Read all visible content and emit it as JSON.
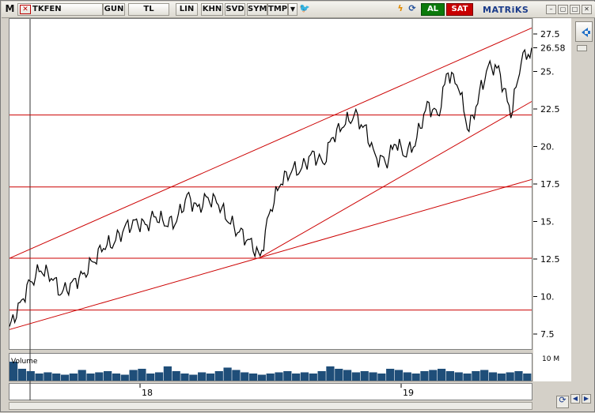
{
  "toolbar": {
    "menu_label": "M",
    "symbol": "TKFEN",
    "buttons": [
      "GUN",
      "TL",
      "LIN",
      "KHN",
      "SVD",
      "SYM",
      "TMP"
    ],
    "al_label": "AL",
    "sat_label": "SAT",
    "logo": "MATRiKS"
  },
  "colors": {
    "price_line": "#000000",
    "level_line": "#cc0000",
    "volume_bar": "#1f4e79",
    "current_price_tag": "#000000"
  },
  "chart_data": {
    "type": "line",
    "title": "",
    "xlabel": "",
    "ylabel": "",
    "ylim": [
      6.5,
      28.5
    ],
    "y_ticks": [
      "27.5",
      "25.",
      "22.5",
      "20.",
      "17.5",
      "15.",
      "12.5",
      "10.",
      "7.5"
    ],
    "y_tick_values": [
      27.5,
      25,
      22.5,
      20,
      17.5,
      15,
      12.5,
      10,
      7.5
    ],
    "current_price": "26.58",
    "x_tick_labels": [
      "18",
      "19"
    ],
    "x_tick_positions": [
      0.25,
      0.75
    ],
    "grid": false,
    "horizontal_levels": [
      22.1,
      17.3,
      12.55,
      9.1
    ],
    "trend_lines": [
      {
        "from": [
          0.0,
          12.55
        ],
        "to": [
          1.0,
          27.9
        ]
      },
      {
        "from": [
          0.0,
          7.8
        ],
        "to": [
          0.48,
          12.6
        ]
      },
      {
        "from": [
          0.48,
          12.6
        ],
        "to": [
          1.0,
          23.0
        ]
      },
      {
        "from": [
          0.48,
          12.6
        ],
        "to": [
          1.0,
          17.8
        ]
      }
    ],
    "series": [
      {
        "values": [
          [
            0.0,
            8.0
          ],
          [
            0.02,
            9.6
          ],
          [
            0.04,
            11.0
          ],
          [
            0.06,
            11.7
          ],
          [
            0.08,
            11.2
          ],
          [
            0.1,
            10.2
          ],
          [
            0.12,
            11.0
          ],
          [
            0.14,
            11.5
          ],
          [
            0.16,
            12.3
          ],
          [
            0.18,
            13.2
          ],
          [
            0.2,
            13.5
          ],
          [
            0.22,
            14.6
          ],
          [
            0.24,
            15.1
          ],
          [
            0.26,
            14.8
          ],
          [
            0.28,
            15.3
          ],
          [
            0.3,
            14.7
          ],
          [
            0.32,
            15.0
          ],
          [
            0.34,
            16.8
          ],
          [
            0.36,
            16.0
          ],
          [
            0.38,
            16.6
          ],
          [
            0.4,
            16.1
          ],
          [
            0.42,
            14.9
          ],
          [
            0.44,
            14.3
          ],
          [
            0.46,
            13.8
          ],
          [
            0.48,
            12.7
          ],
          [
            0.5,
            15.8
          ],
          [
            0.52,
            17.5
          ],
          [
            0.54,
            18.3
          ],
          [
            0.56,
            18.6
          ],
          [
            0.58,
            19.7
          ],
          [
            0.6,
            18.9
          ],
          [
            0.62,
            20.6
          ],
          [
            0.64,
            21.3
          ],
          [
            0.66,
            22.1
          ],
          [
            0.68,
            21.4
          ],
          [
            0.7,
            19.5
          ],
          [
            0.72,
            18.9
          ],
          [
            0.74,
            20.1
          ],
          [
            0.76,
            19.3
          ],
          [
            0.78,
            20.6
          ],
          [
            0.8,
            23.0
          ],
          [
            0.82,
            22.1
          ],
          [
            0.84,
            24.9
          ],
          [
            0.86,
            23.8
          ],
          [
            0.88,
            21.0
          ],
          [
            0.9,
            23.7
          ],
          [
            0.92,
            25.7
          ],
          [
            0.94,
            24.8
          ],
          [
            0.96,
            21.9
          ],
          [
            0.98,
            25.6
          ],
          [
            1.0,
            26.58
          ]
        ]
      }
    ],
    "volume": {
      "label": "Volume",
      "unit_label": "10 M",
      "values": [
        0.8,
        0.5,
        0.4,
        0.3,
        0.35,
        0.3,
        0.25,
        0.3,
        0.45,
        0.3,
        0.35,
        0.4,
        0.3,
        0.25,
        0.45,
        0.5,
        0.3,
        0.35,
        0.6,
        0.4,
        0.3,
        0.25,
        0.35,
        0.3,
        0.4,
        0.55,
        0.45,
        0.35,
        0.3,
        0.25,
        0.3,
        0.35,
        0.4,
        0.3,
        0.35,
        0.3,
        0.4,
        0.6,
        0.5,
        0.45,
        0.35,
        0.4,
        0.35,
        0.3,
        0.5,
        0.45,
        0.35,
        0.3,
        0.4,
        0.45,
        0.5,
        0.4,
        0.35,
        0.3,
        0.4,
        0.45,
        0.35,
        0.3,
        0.35,
        0.4,
        0.3
      ]
    }
  }
}
